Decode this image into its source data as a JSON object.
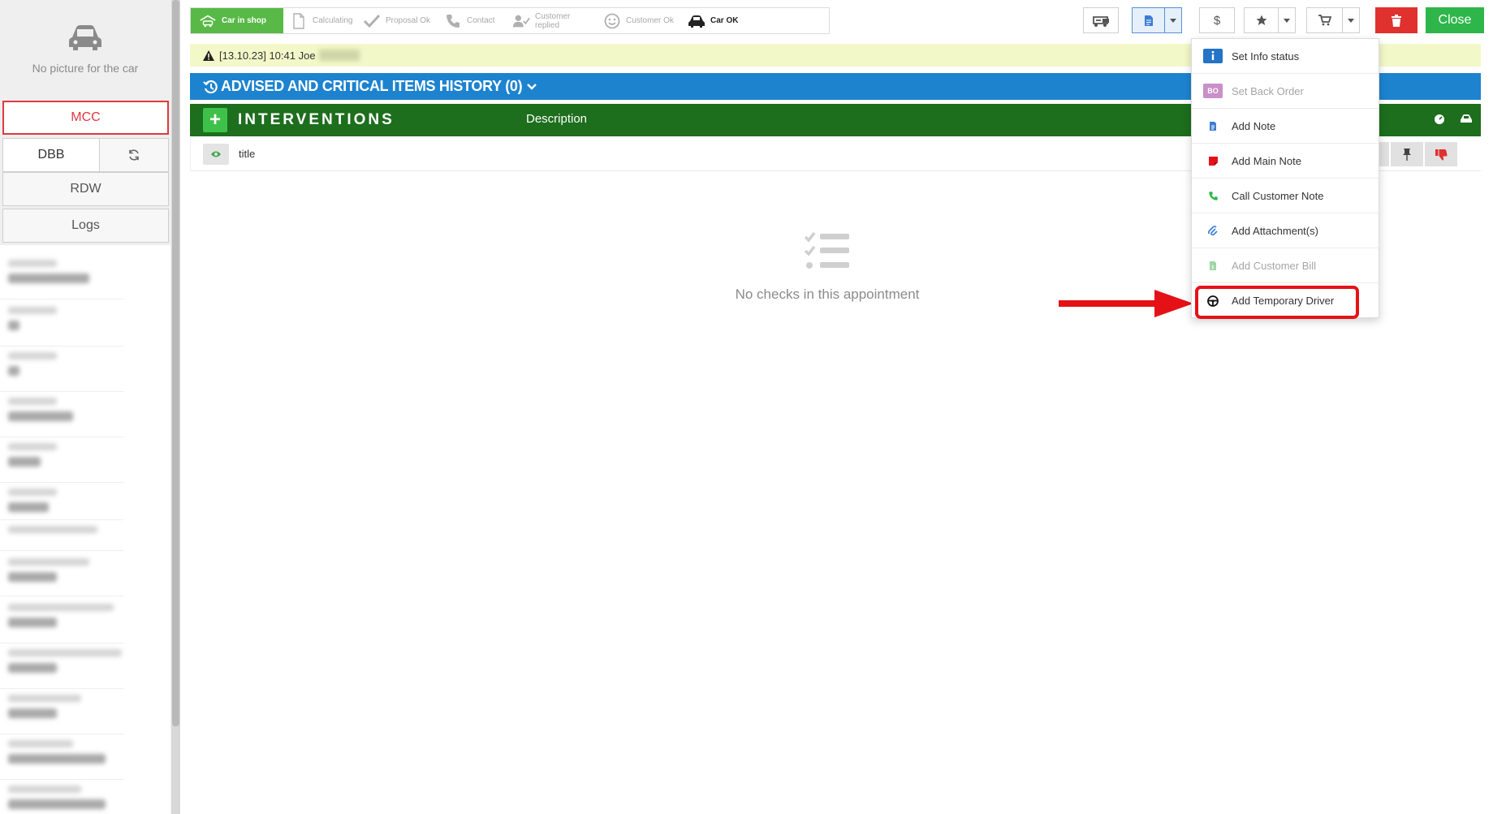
{
  "sidebar": {
    "no_picture": "No picture for the car",
    "mcc_label": "MCC",
    "dbb_label": "DBB",
    "rdw_label": "RDW",
    "logs_label": "Logs"
  },
  "steps": [
    {
      "label": "Car in shop",
      "icon": "car-in-shop-icon"
    },
    {
      "label": "Calculating",
      "icon": "document-icon"
    },
    {
      "label": "Proposal Ok",
      "icon": "check-icon"
    },
    {
      "label": "Contact",
      "icon": "phone-icon"
    },
    {
      "label": "Customer replied",
      "icon": "user-check-icon"
    },
    {
      "label": "Customer Ok",
      "icon": "smile-icon"
    },
    {
      "label": "Car OK",
      "icon": "car-icon"
    }
  ],
  "toolbar": {
    "close_label": "Close",
    "dollar_label": "$"
  },
  "notice": {
    "text": "[13.10.23] 10:41 Joe"
  },
  "advised": {
    "title": "ADVISED AND CRITICAL ITEMS HISTORY (0)"
  },
  "interventions": {
    "title": "INTERVENTIONS",
    "description_header": "Description",
    "rows": [
      {
        "title": "title"
      }
    ]
  },
  "empty_state": {
    "text": "No checks in this appointment"
  },
  "menu": {
    "items": [
      {
        "label": "Set Info status",
        "icon": "info-icon",
        "disabled": false
      },
      {
        "label": "Set Back Order",
        "icon": "bo-badge-icon",
        "badge": "BO",
        "disabled": true
      },
      {
        "label": "Add Note",
        "icon": "note-icon",
        "disabled": false
      },
      {
        "label": "Add Main Note",
        "icon": "main-note-icon",
        "disabled": false
      },
      {
        "label": "Call Customer Note",
        "icon": "phone-icon",
        "disabled": false
      },
      {
        "label": "Add Attachment(s)",
        "icon": "paperclip-icon",
        "disabled": false
      },
      {
        "label": "Add Customer Bill",
        "icon": "bill-icon",
        "disabled": true
      },
      {
        "label": "Add Temporary Driver",
        "icon": "steering-wheel-icon",
        "disabled": false
      }
    ]
  },
  "colors": {
    "mcc_border": "#e0393e",
    "step_active": "#58b947",
    "advised_bar": "#1d83cf",
    "interventions_bar": "#1d6e1d",
    "close_button": "#2eb64a",
    "delete_button": "#e0312f",
    "annotation_red": "#e41217",
    "notice_bg": "#f3f8c8"
  }
}
